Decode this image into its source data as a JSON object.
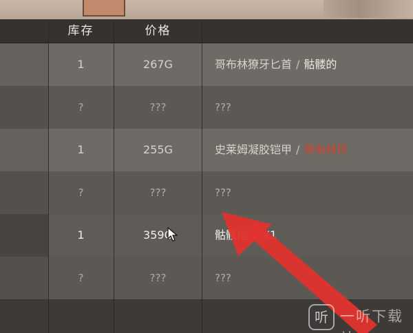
{
  "table": {
    "headers": {
      "stock": "库存",
      "price": "价格",
      "name": ""
    },
    "rows": [
      {
        "stock": "1",
        "price": "267G",
        "name": "哥布林獠牙匕首",
        "separator": "/",
        "extra": "骷髅的",
        "extra_color": "#e8e4de",
        "state": "known"
      },
      {
        "stock": "?",
        "price": "???",
        "name": "???",
        "state": "unknown"
      },
      {
        "stock": "1",
        "price": "255G",
        "name": "史莱姆凝胶铠甲",
        "separator": "/",
        "extra": "哥布林符",
        "extra_color": "#d2452f",
        "state": "known"
      },
      {
        "stock": "?",
        "price": "???",
        "name": "???",
        "state": "unknown"
      },
      {
        "stock": "1",
        "price": "359G",
        "name": "骷髅指骨 X1",
        "state": "known-selected"
      },
      {
        "stock": "?",
        "price": "???",
        "name": "???",
        "state": "unknown"
      }
    ]
  },
  "watermark": {
    "logo": "听",
    "text": "一听下载站"
  },
  "colors": {
    "arrow": "#e0332e",
    "highlight_text": "#d2452f"
  },
  "icons": {
    "cursor": "mouse-pointer-icon",
    "arrow": "red-arrow-annotation"
  }
}
